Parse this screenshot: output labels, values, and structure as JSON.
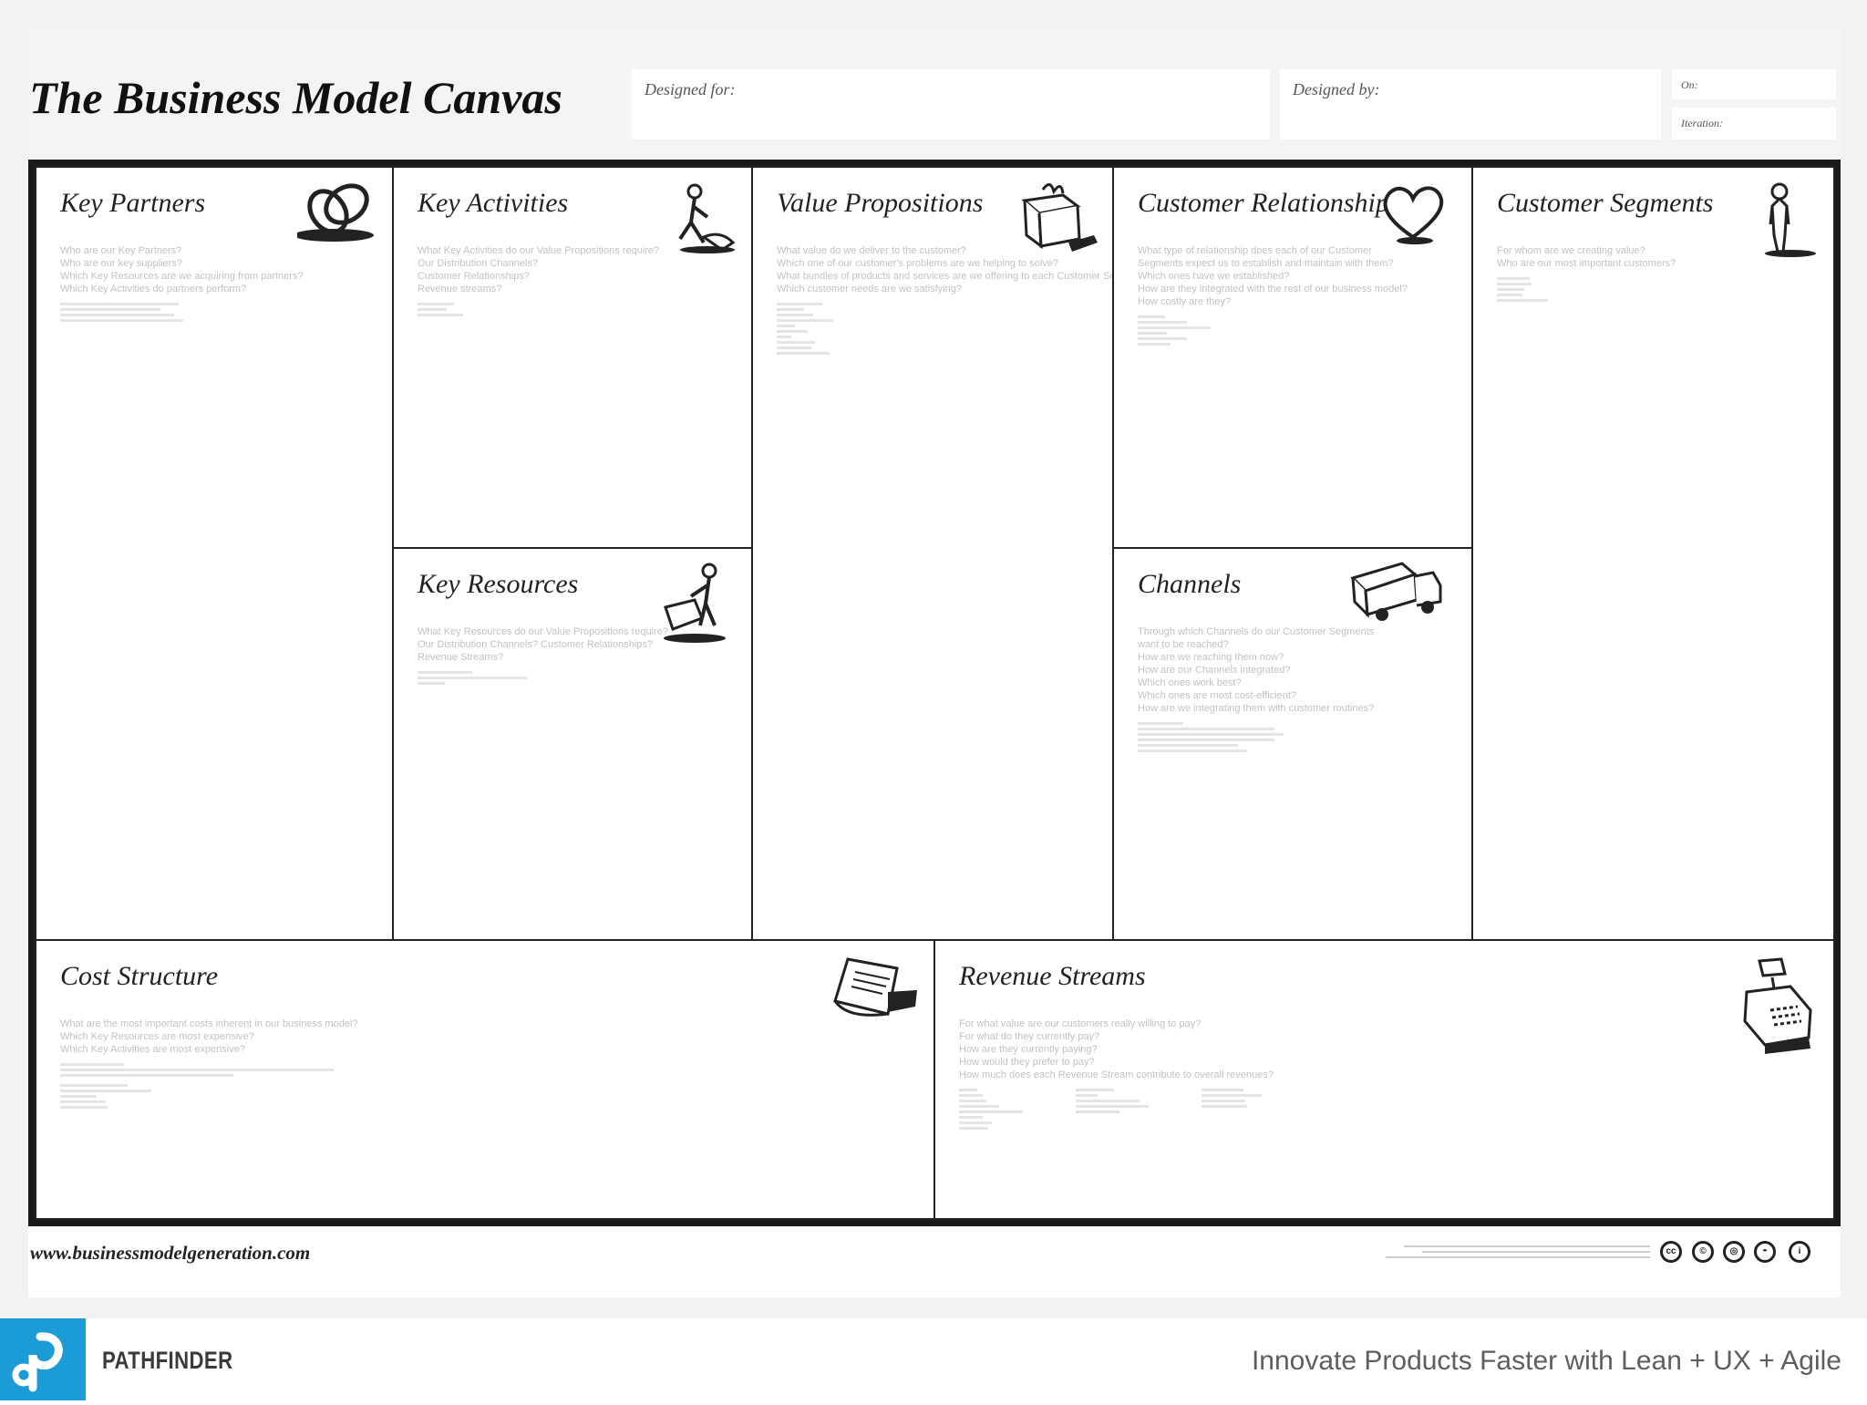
{
  "header": {
    "title": "The Business Model Canvas",
    "designed_for_label": "Designed for:",
    "designed_by_label": "Designed by:",
    "on_label": "On:",
    "iteration_label": "Iteration:"
  },
  "canvas": {
    "key_partners": {
      "title": "Key Partners",
      "icon": "chain-links-icon",
      "questions": [
        "Who are our Key Partners?",
        "Who are our key suppliers?",
        "Which Key Resources are we acquiring from partners?",
        "Which Key Activities do partners perform?"
      ]
    },
    "key_activities": {
      "title": "Key Activities",
      "icon": "worker-icon",
      "questions": [
        "What Key Activities do our Value Propositions require?",
        "Our Distribution Channels?",
        "Customer Relationships?",
        "Revenue streams?"
      ]
    },
    "key_resources": {
      "title": "Key Resources",
      "icon": "worker-with-crate-icon",
      "questions": [
        "What Key Resources do our Value Propositions require?",
        "Our Distribution Channels? Customer Relationships?",
        "Revenue Streams?"
      ]
    },
    "value_propositions": {
      "title": "Value Propositions",
      "icon": "gift-icon",
      "questions": [
        "What value do we deliver to the customer?",
        "Which one of our customer's problems are we helping to solve?",
        "What bundles of products and services are we offering to each Customer Segment?",
        "Which customer needs are we satisfying?"
      ]
    },
    "customer_relationships": {
      "title": "Customer Relationships",
      "icon": "heart-icon",
      "questions": [
        "What type of relationship does each of our Customer",
        "Segments expect us to establish and maintain with them?",
        "Which ones have we established?",
        "How are they integrated with the rest of our business model?",
        "How costly are they?"
      ]
    },
    "channels": {
      "title": "Channels",
      "icon": "truck-icon",
      "questions": [
        "Through which Channels do our Customer Segments",
        "want to be reached?",
        "How are we reaching them now?",
        "How are our Channels integrated?",
        "Which ones work best?",
        "Which ones are most cost-efficient?",
        "How are we integrating them with customer routines?"
      ]
    },
    "customer_segments": {
      "title": "Customer Segments",
      "icon": "person-icon",
      "questions": [
        "For whom are we creating value?",
        "Who are our most important customers?"
      ]
    },
    "cost_structure": {
      "title": "Cost Structure",
      "icon": "receipt-icon",
      "questions": [
        "What are the most important costs inherent in our business model?",
        "Which Key Resources are most expensive?",
        "Which Key Activities are most expensive?"
      ]
    },
    "revenue_streams": {
      "title": "Revenue Streams",
      "icon": "cash-register-icon",
      "questions": [
        "For what value are our customers really willing to pay?",
        "For what do they currently pay?",
        "How are they currently paying?",
        "How would they prefer to pay?",
        "How much does each Revenue Stream contribute to overall revenues?"
      ]
    }
  },
  "footer": {
    "url": "www.businessmodelgeneration.com",
    "license_icons": [
      "cc-icon",
      "attribution-icon",
      "share-alike-icon",
      "noncommercial-icon",
      "info-icon"
    ]
  },
  "bottom_bar": {
    "logo_icon": "pathfinder-logo-icon",
    "brand": "PATHFINDER",
    "tagline": "Innovate Products Faster with Lean + UX + Agile",
    "brand_color": "#1b9cd7"
  }
}
